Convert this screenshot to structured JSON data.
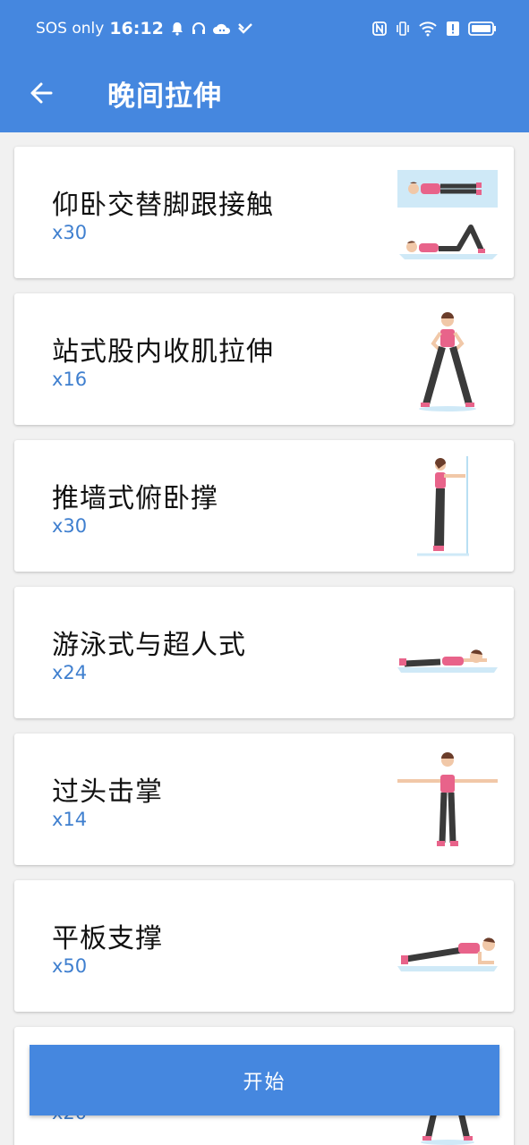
{
  "status_bar": {
    "carrier": "SOS only",
    "time": "16:12",
    "icons": [
      "bell-icon",
      "headset-icon",
      "cloud-icon",
      "app-icon",
      "nfc-icon",
      "vibrate-icon",
      "wifi-icon",
      "alert-icon",
      "battery-icon"
    ]
  },
  "header": {
    "title": "晚间拉伸",
    "back_icon": "arrow-left-icon"
  },
  "exercises": [
    {
      "name": "仰卧交替脚跟接触",
      "reps": "x30"
    },
    {
      "name": "站式股内收肌拉伸",
      "reps": "x16"
    },
    {
      "name": "推墙式俯卧撑",
      "reps": "x30"
    },
    {
      "name": "游泳式与超人式",
      "reps": "x24"
    },
    {
      "name": "过头击掌",
      "reps": "x14"
    },
    {
      "name": "平板支撑",
      "reps": "x50"
    },
    {
      "name": "",
      "reps": "x20"
    }
  ],
  "start_button": {
    "label": "开始"
  },
  "colors": {
    "primary": "#4587df",
    "reps_text": "#3f7fcf",
    "pink": "#e8638a",
    "legging": "#3a3a3a",
    "mat": "#cfe9f7"
  }
}
